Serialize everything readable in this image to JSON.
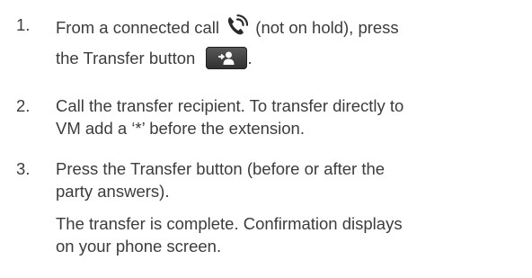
{
  "steps": [
    {
      "number": "1.",
      "line1_before_icon": "From a connected call ",
      "line1_after_icon": " (not on hold), press",
      "line2_before_button": "the Transfer button ",
      "line2_after_button": ".",
      "icon": "phone-connected-icon",
      "button_icon": "transfer-button-icon"
    },
    {
      "number": "2.",
      "lines": [
        "Call the transfer recipient. To transfer directly to",
        "VM add a ‘*’ before the extension."
      ]
    },
    {
      "number": "3.",
      "lines": [
        "Press the Transfer button (before or after the",
        "party answers)."
      ],
      "followup_lines": [
        "The transfer is complete. Confirmation displays",
        "on your phone screen."
      ]
    }
  ],
  "colors": {
    "text": "#3c3c3c",
    "icon": "#2a2a2a",
    "button_bg": "#3e3e3e",
    "button_icon": "#ffffff"
  }
}
